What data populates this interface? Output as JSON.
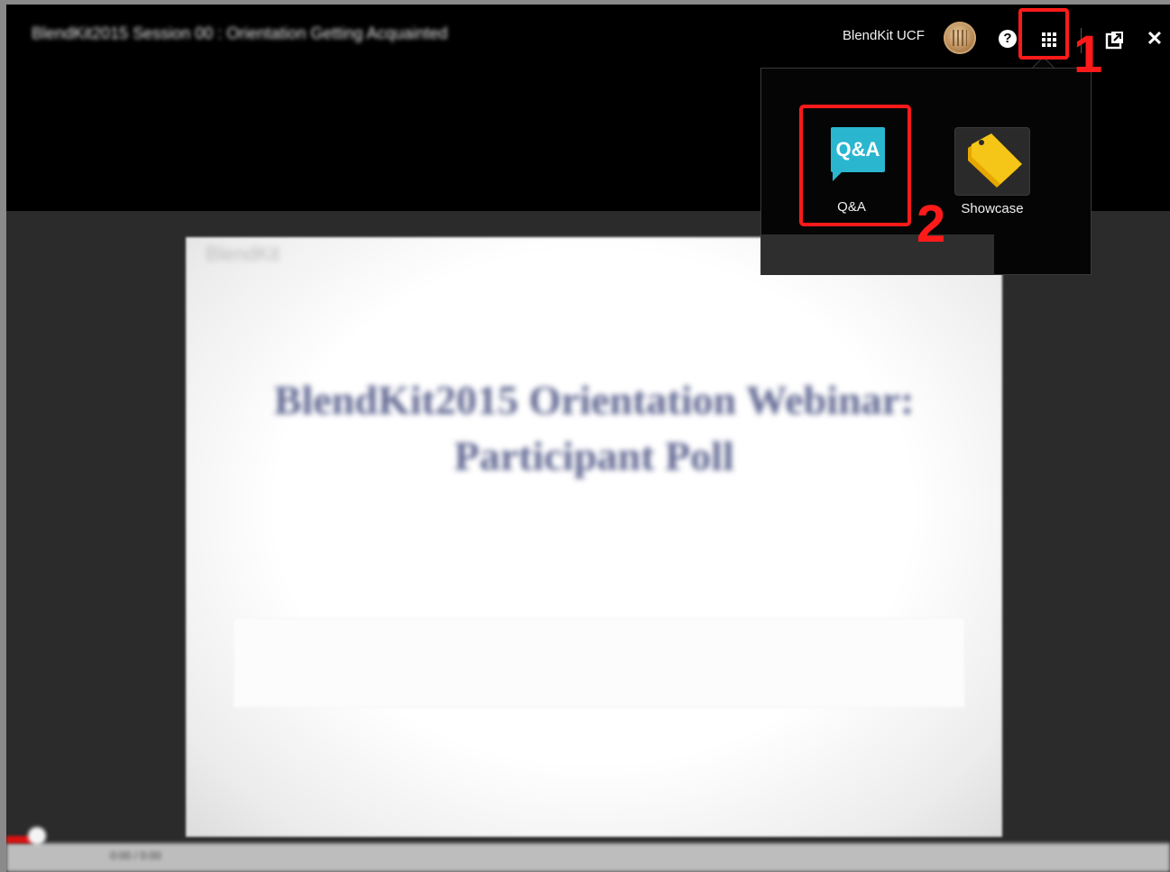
{
  "window": {
    "title": "BlendKit2015 Session 00 : Orientation Getting Acquainted"
  },
  "header": {
    "user_name": "BlendKit UCF",
    "help_symbol": "?",
    "close_symbol": "✕",
    "icons": [
      "avatar",
      "help-icon",
      "apps-grid-icon",
      "popout-icon",
      "close-icon"
    ]
  },
  "apps_menu": {
    "items": [
      {
        "label": "Q&A",
        "icon_text": "Q&A",
        "icon": "qa-icon",
        "color": "#2ab6cf"
      },
      {
        "label": "Showcase",
        "icon": "showcase-tag-icon",
        "color": "#f5c518"
      }
    ]
  },
  "slide": {
    "logo_text": "BlendKit",
    "title_line1": "BlendKit2015 Orientation Webinar:",
    "title_line2": "Participant Poll"
  },
  "player": {
    "time_text": "0:00 / 0:00",
    "progress_fraction": 0.02
  },
  "annotations": {
    "step1": "1",
    "step2": "2",
    "highlight_color": "#ff1a1a"
  }
}
